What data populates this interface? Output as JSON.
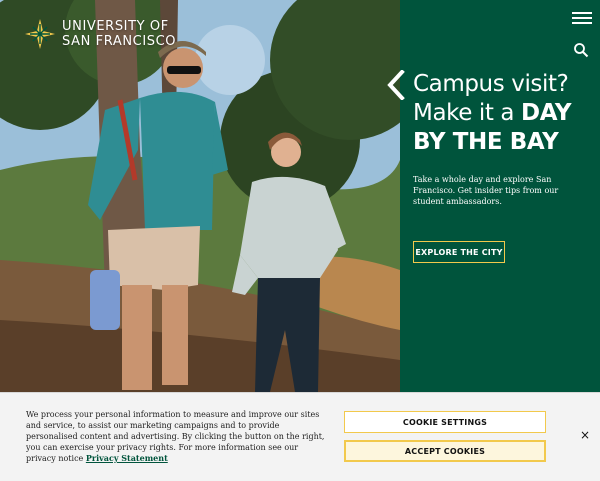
{
  "brand": {
    "line1": "UNIVERSITY OF",
    "line2": "SAN FRANCISCO",
    "logo_icon": "usf-logo-mark-icon"
  },
  "header": {
    "menu_icon": "hamburger-menu-icon",
    "search_icon": "search-icon"
  },
  "hero": {
    "image_alt": "Two students hiking on a wooded trail",
    "headline_part1": "Campus visit?",
    "headline_part2": "Make it a ",
    "headline_bold": "DAY BY THE BAY",
    "description": "Take a whole day and explore San Francisco. Get insider tips from our student ambassadors.",
    "cta_label": "EXPLORE THE CITY",
    "prev_icon": "chevron-left-icon"
  },
  "cookie": {
    "message": "We process your personal information to measure and improve our sites and service, to assist our marketing campaigns and to provide personalised content and advertising. By clicking the button on the right, you can exercise your privacy rights. For more information see our privacy notice",
    "link_label": "Privacy Statement",
    "settings_label": "COOKIE SETTINGS",
    "accept_label": "ACCEPT COOKIES",
    "close_label": "×"
  },
  "colors": {
    "brand_green": "#00543c",
    "brand_gold": "#f2c94c",
    "cookie_bg": "#f3f3f3"
  }
}
